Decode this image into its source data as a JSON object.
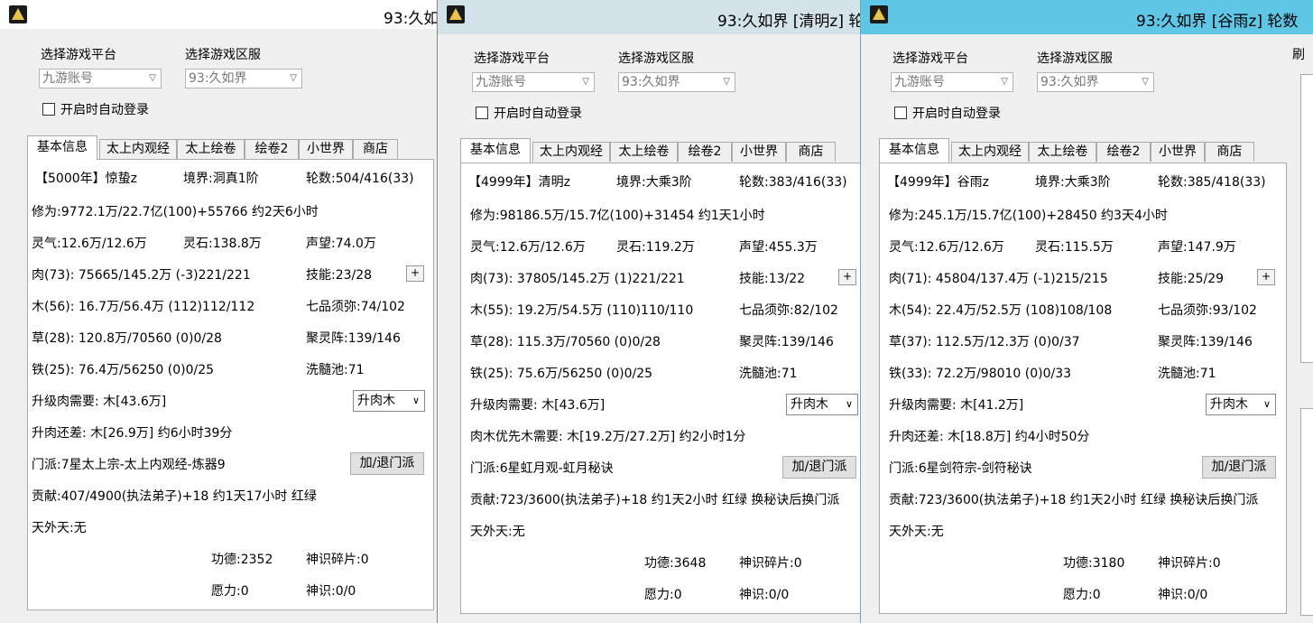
{
  "windows": [
    {
      "title": "93:久如",
      "platform_label": "选择游戏平台",
      "server_label": "选择游戏区服",
      "platform_value": "九游账号",
      "server_value": "93:久如界",
      "auto_login_label": "开启时自动登录",
      "tabs": [
        "基本信息",
        "太上内观经",
        "太上绘卷",
        "绘卷2",
        "小世界",
        "商店"
      ],
      "info": {
        "name": "【5000年】惊蛰z",
        "realm": "境界:洞真1阶",
        "rounds": "轮数:504/416(33)",
        "cultivation": "修为:9772.1万/22.7亿(100)+55766 约2天6小时",
        "lingqi": "灵气:12.6万/12.6万",
        "lingshi": "灵石:138.8万",
        "prestige": "声望:74.0万",
        "rou": "肉(73): 75665/145.2万 (-3)221/221",
        "skill": "技能:23/28",
        "mu": "木(56): 16.7万/56.4万 (112)112/112",
        "qipin": "七品须弥:74/102",
        "cao": "草(28): 120.8万/70560 (0)0/28",
        "juling": "聚灵阵:139/146",
        "tie": "铁(25): 76.4万/56250 (0)0/25",
        "xisui": "洗髓池:71",
        "upgrade_need": "升级肉需要: 木[43.6万]",
        "upgrade_select": "升肉木",
        "upgrade_diff": "升肉还差: 木[26.9万] 约6小时39分",
        "sect": "门派:7星太上宗-太上内观经-炼器9",
        "sect_btn": "加/退门派",
        "contrib": "贡献:407/4900(执法弟子)+18 约1天17小时 红绿",
        "tianwai": "天外天:无",
        "gongde": "功德:2352",
        "shenshi_sp": "神识碎片:0",
        "yuanli": "愿力:0",
        "shenshi": "神识:0/0"
      },
      "plus": "+"
    },
    {
      "title": "93:久如界 [清明z] 轮",
      "platform_label": "选择游戏平台",
      "server_label": "选择游戏区服",
      "platform_value": "九游账号",
      "server_value": "93:久如界",
      "auto_login_label": "开启时自动登录",
      "tabs": [
        "基本信息",
        "太上内观经",
        "太上绘卷",
        "绘卷2",
        "小世界",
        "商店"
      ],
      "info": {
        "name": "【4999年】清明z",
        "realm": "境界:大乘3阶",
        "rounds": "轮数:383/416(33)",
        "cultivation": "修为:98186.5万/15.7亿(100)+31454 约1天1小时",
        "lingqi": "灵气:12.6万/12.6万",
        "lingshi": "灵石:119.2万",
        "prestige": "声望:455.3万",
        "rou": "肉(73): 37805/145.2万 (1)221/221",
        "skill": "技能:13/22",
        "mu": "木(55): 19.2万/54.5万 (110)110/110",
        "qipin": "七品须弥:82/102",
        "cao": "草(28): 115.3万/70560 (0)0/28",
        "juling": "聚灵阵:139/146",
        "tie": "铁(25): 75.6万/56250 (0)0/25",
        "xisui": "洗髓池:71",
        "upgrade_need": "升级肉需要: 木[43.6万]",
        "upgrade_select": "升肉木",
        "upgrade_diff": "肉木优先木需要: 木[19.2万/27.2万] 约2小时1分",
        "sect": "门派:6星虹月观-虹月秘诀",
        "sect_btn": "加/退门派",
        "contrib": "贡献:723/3600(执法弟子)+18 约1天2小时 红绿 换秘诀后换门派",
        "tianwai": "天外天:无",
        "gongde": "功德:3648",
        "shenshi_sp": "神识碎片:0",
        "yuanli": "愿力:0",
        "shenshi": "神识:0/0"
      },
      "plus": "+"
    },
    {
      "title": "93:久如界 [谷雨z] 轮数",
      "platform_label": "选择游戏平台",
      "server_label": "选择游戏区服",
      "platform_value": "九游账号",
      "server_value": "93:久如界",
      "auto_login_label": "开启时自动登录",
      "tabs": [
        "基本信息",
        "太上内观经",
        "太上绘卷",
        "绘卷2",
        "小世界",
        "商店"
      ],
      "info": {
        "name": "【4999年】谷雨z",
        "realm": "境界:大乘3阶",
        "rounds": "轮数:385/418(33)",
        "cultivation": "修为:245.1万/15.7亿(100)+28450 约3天4小时",
        "lingqi": "灵气:12.6万/12.6万",
        "lingshi": "灵石:115.5万",
        "prestige": "声望:147.9万",
        "rou": "肉(71): 45804/137.4万 (-1)215/215",
        "skill": "技能:25/29",
        "mu": "木(54): 22.4万/52.5万 (108)108/108",
        "qipin": "七品须弥:93/102",
        "cao": "草(37): 112.5万/12.3万 (0)0/37",
        "juling": "聚灵阵:139/146",
        "tie": "铁(33): 72.2万/98010 (0)0/33",
        "xisui": "洗髓池:71",
        "upgrade_need": "升级肉需要: 木[41.2万]",
        "upgrade_select": "升肉木",
        "upgrade_diff": "升肉还差: 木[18.8万] 约4小时50分",
        "sect": "门派:6星剑符宗-剑符秘诀",
        "sect_btn": "加/退门派",
        "contrib": "贡献:723/3600(执法弟子)+18 约1天2小时 红绿 换秘诀后换门派",
        "tianwai": "天外天:无",
        "gongde": "功德:3180",
        "shenshi_sp": "神识碎片:0",
        "yuanli": "愿力:0",
        "shenshi": "神识:0/0"
      },
      "plus": "+"
    }
  ],
  "side_fragment": "刷"
}
